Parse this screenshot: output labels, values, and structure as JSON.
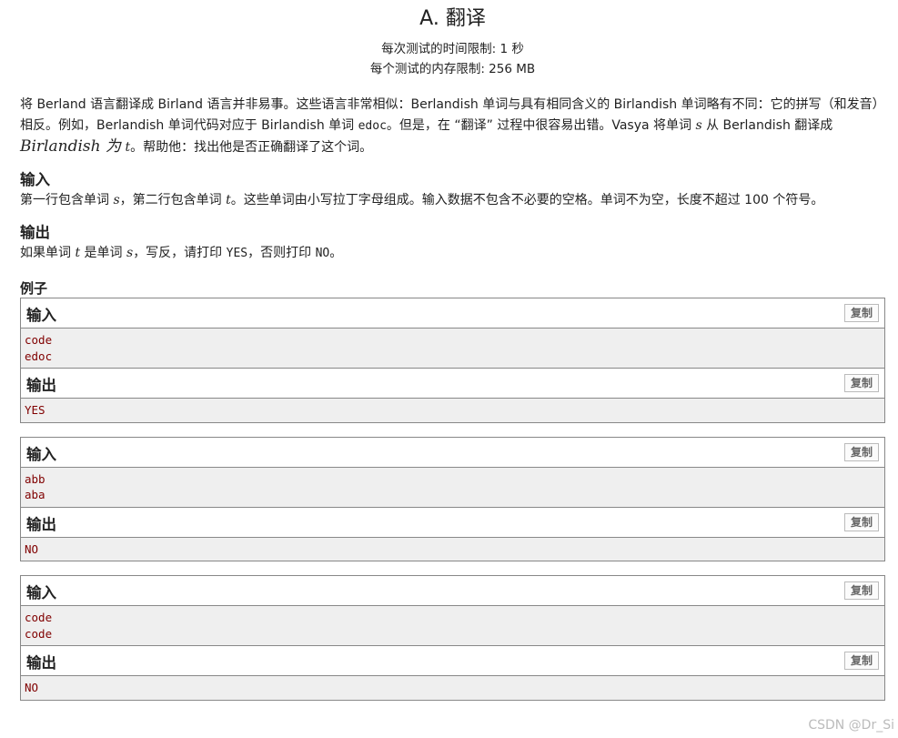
{
  "problem": {
    "title": "A. 翻译",
    "time_limit": "每次测试的时间限制: 1 秒",
    "memory_limit": "每个测试的内存限制: 256 MB"
  },
  "statement": {
    "p1_a": "将 Berland 语言翻译成 Birland 语言并非易事。这些语言非常相似：Berlandish 单词与具有相同含义的 Birlandish 单词略有不同：它的拼写（和发音）相反。例如，Berlandish 单词代码对应于 Birlandish 单词 ",
    "p1_code": "edoc",
    "p1_b": "。但是，在 “翻译” 过程中很容易出错。Vasya 将单词 ",
    "p1_s": "s",
    "p1_c": " 从 Berlandish 翻译成 ",
    "p1_birl": "Birlandish 为",
    "p1_t": "t",
    "p1_d": "。帮助他：找出他是否正确翻译了这个词。"
  },
  "input_section": {
    "heading": "输入",
    "text_a": "第一行包含单词 ",
    "var_s": "s",
    "text_b": "，第二行包含单词 ",
    "var_t": "t",
    "text_c": "。这些单词由小写拉丁字母组成。输入数据不包含不必要的空格。单词不为空，长度不超过 100 个符号。"
  },
  "output_section": {
    "heading": "输出",
    "text_a": "如果单词 ",
    "var_t": "t",
    "text_b": " 是单词 ",
    "var_s": "s",
    "text_c": "，写反，请打印 ",
    "yes": "YES",
    "text_d": "，否则打印 ",
    "no": "NO",
    "text_e": "。"
  },
  "examples": {
    "heading": "例子",
    "input_label": "输入",
    "output_label": "输出",
    "copy_label": "复制",
    "tests": [
      {
        "input": [
          "code",
          "edoc"
        ],
        "output": [
          "YES"
        ]
      },
      {
        "input": [
          "abb",
          "aba"
        ],
        "output": [
          "NO"
        ]
      },
      {
        "input": [
          "code",
          "code"
        ],
        "output": [
          "NO"
        ]
      }
    ]
  },
  "watermark": "CSDN @Dr_Si"
}
